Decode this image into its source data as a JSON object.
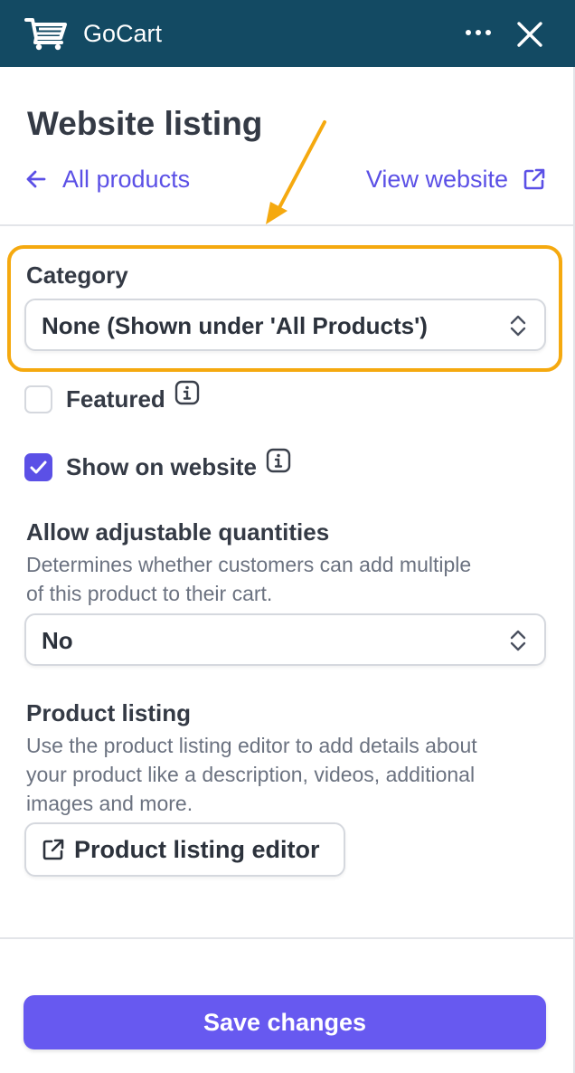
{
  "header": {
    "app_title": "GoCart",
    "icons": {
      "cart": "shopping-cart-icon",
      "more": "more-horizontal-icon",
      "close": "close-icon"
    }
  },
  "page": {
    "title": "Website listing",
    "back_link": "All products",
    "view_link": "View website"
  },
  "category": {
    "label": "Category",
    "selected": "None (Shown under 'All Products')"
  },
  "featured": {
    "label": "Featured",
    "checked": false
  },
  "show_on_website": {
    "label": "Show on website",
    "checked": true
  },
  "quantities": {
    "label": "Allow adjustable quantities",
    "help_line1": "Determines whether customers can add multiple",
    "help_line2": "of this product to their cart.",
    "selected": "No"
  },
  "product_listing": {
    "label": "Product listing",
    "help_line1": "Use the product listing editor to add details about",
    "help_line2": "your product like a description, videos, additional",
    "help_line3": "images and more.",
    "button_label": "Product listing editor"
  },
  "footer": {
    "save_label": "Save changes"
  },
  "colors": {
    "header_bg": "#134a63",
    "accent": "#5b50e6",
    "save_button": "#6759f0",
    "annotation": "#f5a90f"
  }
}
